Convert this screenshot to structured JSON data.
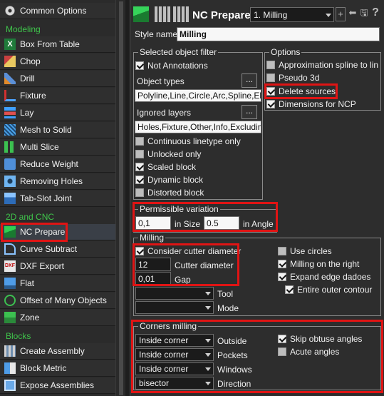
{
  "sidebar": {
    "items": [
      {
        "label": "Common Options",
        "icon": "gear-icon"
      },
      {
        "label": "Box From Table",
        "icon": "excel-icon"
      },
      {
        "label": "Chop",
        "icon": "chop-icon"
      },
      {
        "label": "Drill",
        "icon": "drill-icon"
      },
      {
        "label": "Fixture",
        "icon": "fixture-icon"
      },
      {
        "label": "Lay",
        "icon": "lay-icon"
      },
      {
        "label": "Mesh to Solid",
        "icon": "mesh-icon"
      },
      {
        "label": "Multi Slice",
        "icon": "slice-icon"
      },
      {
        "label": "Reduce Weight",
        "icon": "weight-icon"
      },
      {
        "label": "Removing Holes",
        "icon": "holes-icon"
      },
      {
        "label": "Tab-Slot Joint",
        "icon": "tab-slot-icon"
      },
      {
        "label": "NC Prepare",
        "icon": "nc-prepare-icon"
      },
      {
        "label": "Curve Subtract",
        "icon": "curve-subtract-icon"
      },
      {
        "label": "DXF Export",
        "icon": "dxf-icon"
      },
      {
        "label": "Flat",
        "icon": "flat-icon"
      },
      {
        "label": "Offset of Many Objects",
        "icon": "offset-icon"
      },
      {
        "label": "Zone",
        "icon": "zone-icon"
      },
      {
        "label": "Create Assembly",
        "icon": "assembly-icon"
      },
      {
        "label": "Block Metric",
        "icon": "block-metric-icon"
      },
      {
        "label": "Expose Assemblies",
        "icon": "expose-icon"
      }
    ],
    "sections": {
      "modeling": "Modeling",
      "cnc": "2D and CNC",
      "blocks": "Blocks"
    }
  },
  "panel": {
    "title": "NC Prepare",
    "style_combo": "1. Milling",
    "add_btn": "+",
    "help_btn": "?",
    "style_name_label": "Style name",
    "style_name_value": "Milling",
    "filter": {
      "title": "Selected object filter",
      "not_annotations": "Not Annotations",
      "object_types_label": "Object types",
      "object_types_value": "Polyline,Line,Circle,Arc,Spline,Ellipse",
      "ignored_layers_label": "Ignored layers",
      "ignored_layers_value": "Holes,Fixture,Other,Info,Excluding,Ar",
      "dots": "...",
      "continuous": "Continuous linetype only",
      "unlocked": "Unlocked only",
      "scaled": "Scaled block",
      "dynamic": "Dynamic block",
      "distorted": "Distorted block"
    },
    "options": {
      "title": "Options",
      "approx": "Approximation spline to lin",
      "pseudo": "Pseudo 3d",
      "delete_sources": "Delete sources",
      "dimensions": "Dimensions for NCP"
    },
    "variation": {
      "title": "Permissible variation",
      "size_value": "0,1",
      "size_label": "in Size",
      "angle_value": "0.5",
      "angle_label": "in Angle"
    },
    "milling": {
      "title": "Milling",
      "consider": "Consider cutter diameter",
      "cutter_value": "12",
      "cutter_label": "Cutter diameter",
      "gap_value": "0,01",
      "gap_label": "Gap",
      "tool_label": "Tool",
      "mode_label": "Mode",
      "use_circles": "Use circles",
      "milling_right": "Milling on the right",
      "expand": "Expand edge dadoes",
      "entire": "Entire outer contour"
    },
    "corners": {
      "title": "Corners milling",
      "outside_value": "Inside corner",
      "outside_label": "Outside",
      "pockets_value": "Inside corner",
      "pockets_label": "Pockets",
      "windows_value": "Inside corner",
      "windows_label": "Windows",
      "direction_value": "bisector",
      "direction_label": "Direction",
      "skip_obtuse": "Skip obtuse angles",
      "acute": "Acute angles"
    }
  }
}
